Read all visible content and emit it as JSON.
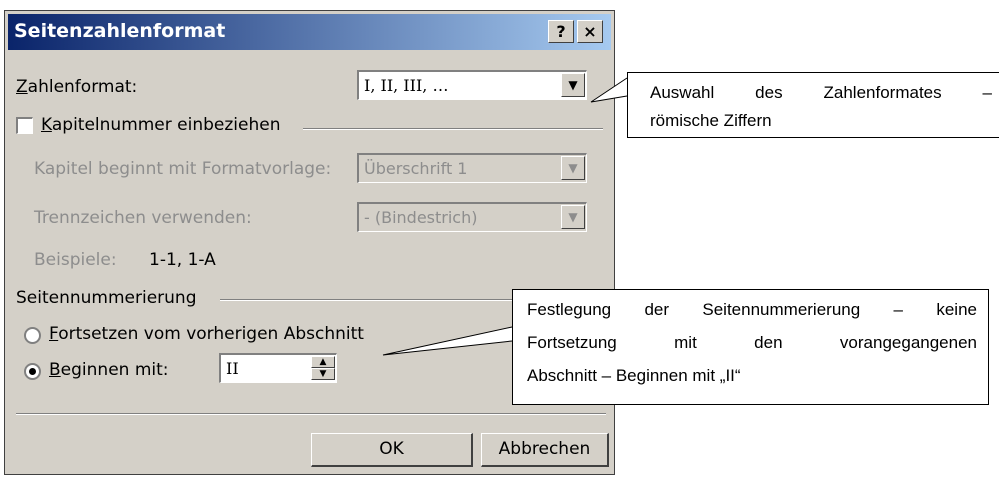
{
  "dialog": {
    "title": "Seitenzahlenformat",
    "help_label": "?",
    "close_label": "×",
    "number_format_label_key": "Z",
    "number_format_label_rest": "ahlenformat:",
    "number_format_value": "I, II, III, …",
    "include_chapter_key": "K",
    "include_chapter_rest": "apitelnummer einbeziehen",
    "include_chapter_checked": false,
    "chapter_style_label": "Kapitel beginnt mit Formatvorlage:",
    "chapter_style_value": "Überschrift 1",
    "separator_label": "Trennzeichen verwenden:",
    "separator_value": "-    (Bindestrich)",
    "examples_label": "Beispiele:",
    "examples_value": "1-1, 1-A",
    "page_numbering_label": "Seitennummerierung",
    "continue_key": "F",
    "continue_rest": "ortsetzen vom vorherigen Abschnitt",
    "start_at_key": "B",
    "start_at_rest": "eginnen mit:",
    "start_at_value": "II",
    "selected_option": "start_at",
    "ok_label": "OK",
    "cancel_label": "Abbrechen"
  },
  "callouts": {
    "format": {
      "line1": "Auswahl des Zahlenformates –",
      "line2": "römische Ziffern"
    },
    "numbering": {
      "line1": "Festlegung der Seitennummerierung – keine",
      "line2": "Fortsetzung mit den vorangegangenen",
      "line3": "Abschnitt – Beginnen mit „II“"
    }
  },
  "icons": {
    "dropdown_arrow": "▼",
    "spin_up": "▲",
    "spin_down": "▼"
  }
}
